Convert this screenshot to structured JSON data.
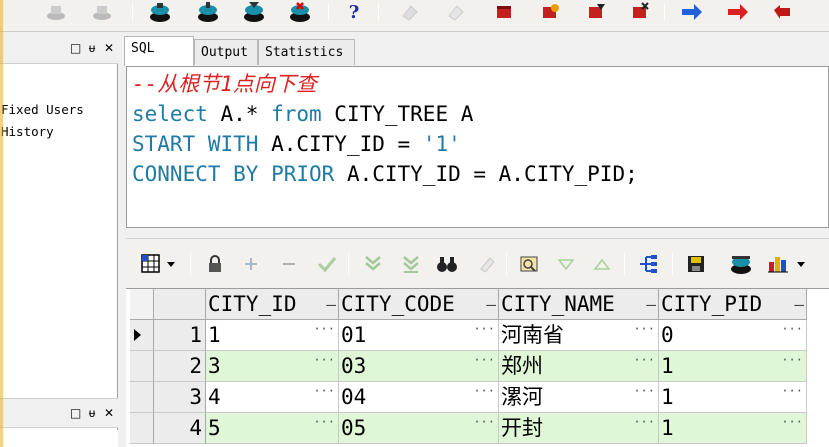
{
  "toolbar": {
    "help_label": "?"
  },
  "left_panel": {
    "header_buttons": [
      "□",
      "ᵾ",
      "✕"
    ],
    "items": [
      "Fixed Users",
      "History"
    ]
  },
  "tabs": [
    {
      "label": "SQL",
      "active": true
    },
    {
      "label": "Output",
      "active": false
    },
    {
      "label": "Statistics",
      "active": false
    }
  ],
  "editor": {
    "comment": "--从根节1点向下查",
    "line1_kw1": "select",
    "line1_mid": " A.* ",
    "line1_kw2": "from",
    "line1_end": " CITY_TREE A",
    "line2_kw": "START WITH",
    "line2_mid": " A.CITY_ID = ",
    "line2_str": "'1'",
    "line3_kw": "CONNECT BY PRIOR",
    "line3_end": " A.CITY_ID = A.CITY_PID;"
  },
  "grid": {
    "columns": [
      "CITY_ID",
      "CITY_CODE",
      "CITY_NAME",
      "CITY_PID"
    ],
    "rows": [
      {
        "n": "1",
        "cells": [
          "1",
          "01",
          "河南省",
          "0"
        ]
      },
      {
        "n": "2",
        "cells": [
          "3",
          "03",
          "郑州",
          "1"
        ]
      },
      {
        "n": "3",
        "cells": [
          "4",
          "04",
          "漯河",
          "1"
        ]
      },
      {
        "n": "4",
        "cells": [
          "5",
          "05",
          "开封",
          "1"
        ]
      }
    ]
  },
  "colors": {
    "keyword": "#1f7aa5",
    "comment": "#dd2222",
    "alt_row": "#dff7d7"
  }
}
